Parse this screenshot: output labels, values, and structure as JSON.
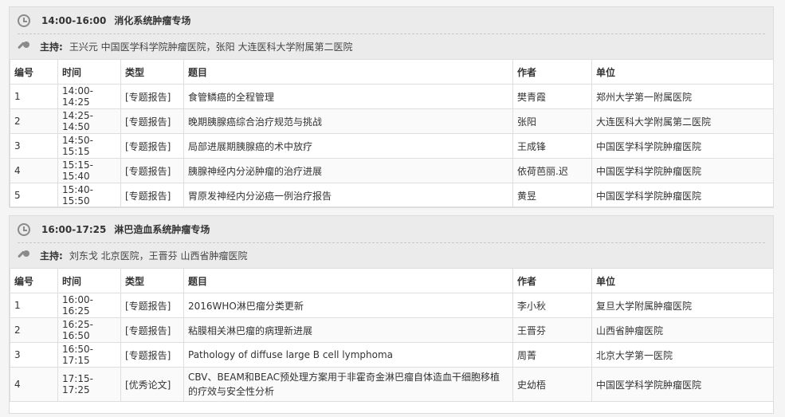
{
  "columns": [
    "编号",
    "时间",
    "类型",
    "题目",
    "作者",
    "单位"
  ],
  "sessions": [
    {
      "time": "14:00-16:00",
      "name": "消化系统肿瘤专场",
      "host_label": "主持:",
      "host_text": "王兴元 中国医学科学院肿瘤医院，张阳 大连医科大学附属第二医院",
      "rows": [
        [
          "1",
          "14:00-14:25",
          "[专题报告]",
          "食管鳞癌的全程管理",
          "樊青霞",
          "郑州大学第一附属医院"
        ],
        [
          "2",
          "14:25-14:50",
          "[专题报告]",
          "晚期胰腺癌综合治疗规范与挑战",
          "张阳",
          "大连医科大学附属第二医院"
        ],
        [
          "3",
          "14:50-15:15",
          "[专题报告]",
          "局部进展期胰腺癌的术中放疗",
          "王成锋",
          "中国医学科学院肿瘤医院"
        ],
        [
          "4",
          "15:15-15:40",
          "[专题报告]",
          "胰腺神经内分泌肿瘤的治疗进展",
          "依荷芭丽.迟",
          "中国医学科学院肿瘤医院"
        ],
        [
          "5",
          "15:40-15:50",
          "[专题报告]",
          "胃原发神经内分泌癌一例治疗报告",
          "黄昱",
          "中国医学科学院肿瘤医院"
        ]
      ]
    },
    {
      "time": "16:00-17:25",
      "name": "淋巴造血系统肿瘤专场",
      "host_label": "主持:",
      "host_text": "刘东戈 北京医院，王晋芬 山西省肿瘤医院",
      "rows": [
        [
          "1",
          "16:00-16:25",
          "[专题报告]",
          "2016WHO淋巴瘤分类更新",
          "李小秋",
          "复旦大学附属肿瘤医院"
        ],
        [
          "2",
          "16:25-16:50",
          "[专题报告]",
          "粘膜相关淋巴瘤的病理新进展",
          "王晋芬",
          "山西省肿瘤医院"
        ],
        [
          "3",
          "16:50-17:15",
          "[专题报告]",
          "Pathology of diffuse large B cell lymphoma",
          "周菁",
          "北京大学第一医院"
        ],
        [
          "4",
          "17:15-17:25",
          "[优秀论文]",
          "CBV、BEAM和BEAC预处理方案用于非霍奇金淋巴瘤自体造血干细胞移植的疗效与安全性分析",
          "史幼梧",
          "中国医学科学院肿瘤医院"
        ]
      ]
    }
  ]
}
